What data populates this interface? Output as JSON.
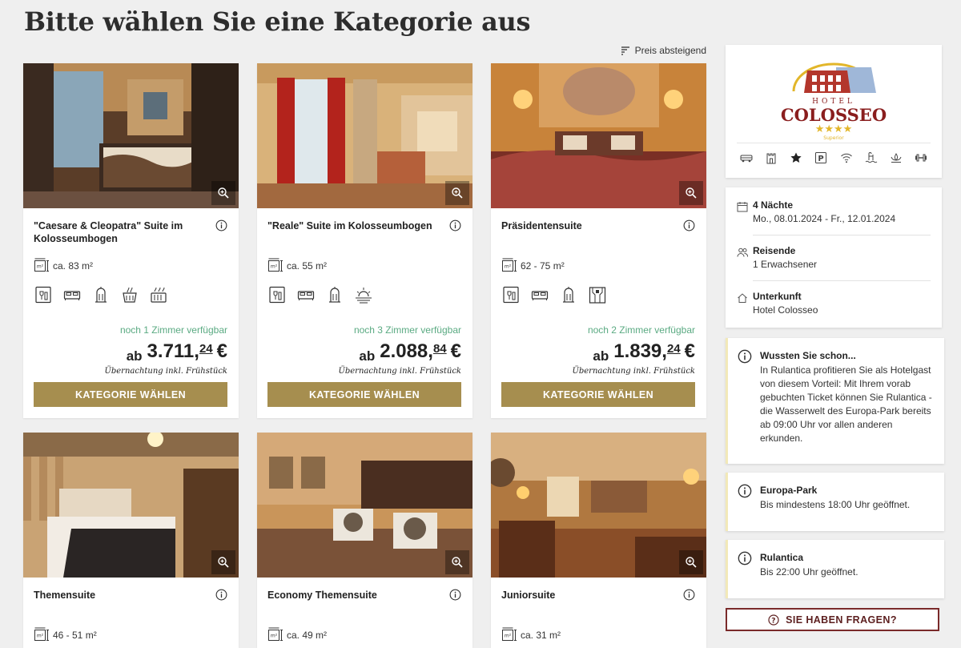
{
  "page": {
    "title": "Bitte wählen Sie eine Kategorie aus",
    "sort_label": "Preis absteigend"
  },
  "rooms": [
    {
      "title": "\"Caesare & Cleopatra\" Suite im Kolosseumbogen",
      "area": "ca. 83 m²",
      "availability": "noch 1 Zimmer verfügbar",
      "price_prefix": "ab",
      "price_main": "3.711,",
      "price_cents": "24",
      "currency": "€",
      "price_note": "Übernachtung inkl. Frühstück",
      "button": "KATEGORIE WÄHLEN",
      "amenities": [
        "minibar-icon",
        "double-bed-icon",
        "heater-icon",
        "wellness-icon",
        "radiator-icon"
      ]
    },
    {
      "title": "\"Reale\" Suite im Kolosseumbogen",
      "area": "ca. 55 m²",
      "availability": "noch 3 Zimmer verfügbar",
      "price_prefix": "ab",
      "price_main": "2.088,",
      "price_cents": "84",
      "currency": "€",
      "price_note": "Übernachtung inkl. Frühstück",
      "button": "KATEGORIE WÄHLEN",
      "amenities": [
        "minibar-icon",
        "double-bed-icon",
        "heater-icon",
        "sunset-view-icon"
      ]
    },
    {
      "title": "Präsidentensuite",
      "area": "62 - 75 m²",
      "availability": "noch 2 Zimmer verfügbar",
      "price_prefix": "ab",
      "price_main": "1.839,",
      "price_cents": "24",
      "currency": "€",
      "price_note": "Übernachtung inkl. Frühstück",
      "button": "KATEGORIE WÄHLEN",
      "amenities": [
        "minibar-icon",
        "double-bed-icon",
        "heater-icon",
        "theme-room-icon"
      ]
    },
    {
      "title": "Themensuite",
      "area": "46 - 51 m²"
    },
    {
      "title": "Economy Themensuite",
      "area": "ca. 49 m²"
    },
    {
      "title": "Juniorsuite",
      "area": "ca. 31 m²"
    }
  ],
  "hotel": {
    "logo_small": "HOTEL",
    "logo_name": "COLOSSEO",
    "logo_stars": "★★★★",
    "logo_tag": "Superior",
    "facilities": [
      "bus-icon",
      "castle-icon",
      "star-icon",
      "parking-icon",
      "wifi-icon",
      "pool-icon",
      "spa-icon",
      "fitness-icon"
    ]
  },
  "trip": {
    "nights_label": "4 Nächte",
    "dates": "Mo., 08.01.2024 - Fr., 12.01.2024",
    "travelers_label": "Reisende",
    "travelers": "1 Erwachsener",
    "accommodation_label": "Unterkunft",
    "accommodation": "Hotel Colosseo"
  },
  "notices": [
    {
      "title": "Wussten Sie schon...",
      "text": "In Rulantica profitieren Sie als Hotelgast von diesem Vorteil: Mit Ihrem vorab gebuchten Ticket können Sie Rulantica - die Wasserwelt des Europa-Park bereits ab 09:00 Uhr vor allen anderen erkunden."
    },
    {
      "title": "Europa-Park",
      "text": "Bis mindestens 18:00 Uhr geöffnet."
    },
    {
      "title": "Rulantica",
      "text": "Bis 22:00 Uhr geöffnet."
    }
  ],
  "faq_button": "SIE HABEN FRAGEN?",
  "colors": {
    "gold": "#a68e4f",
    "available_green": "#5aaa82",
    "burgundy": "#7a2a2a"
  }
}
